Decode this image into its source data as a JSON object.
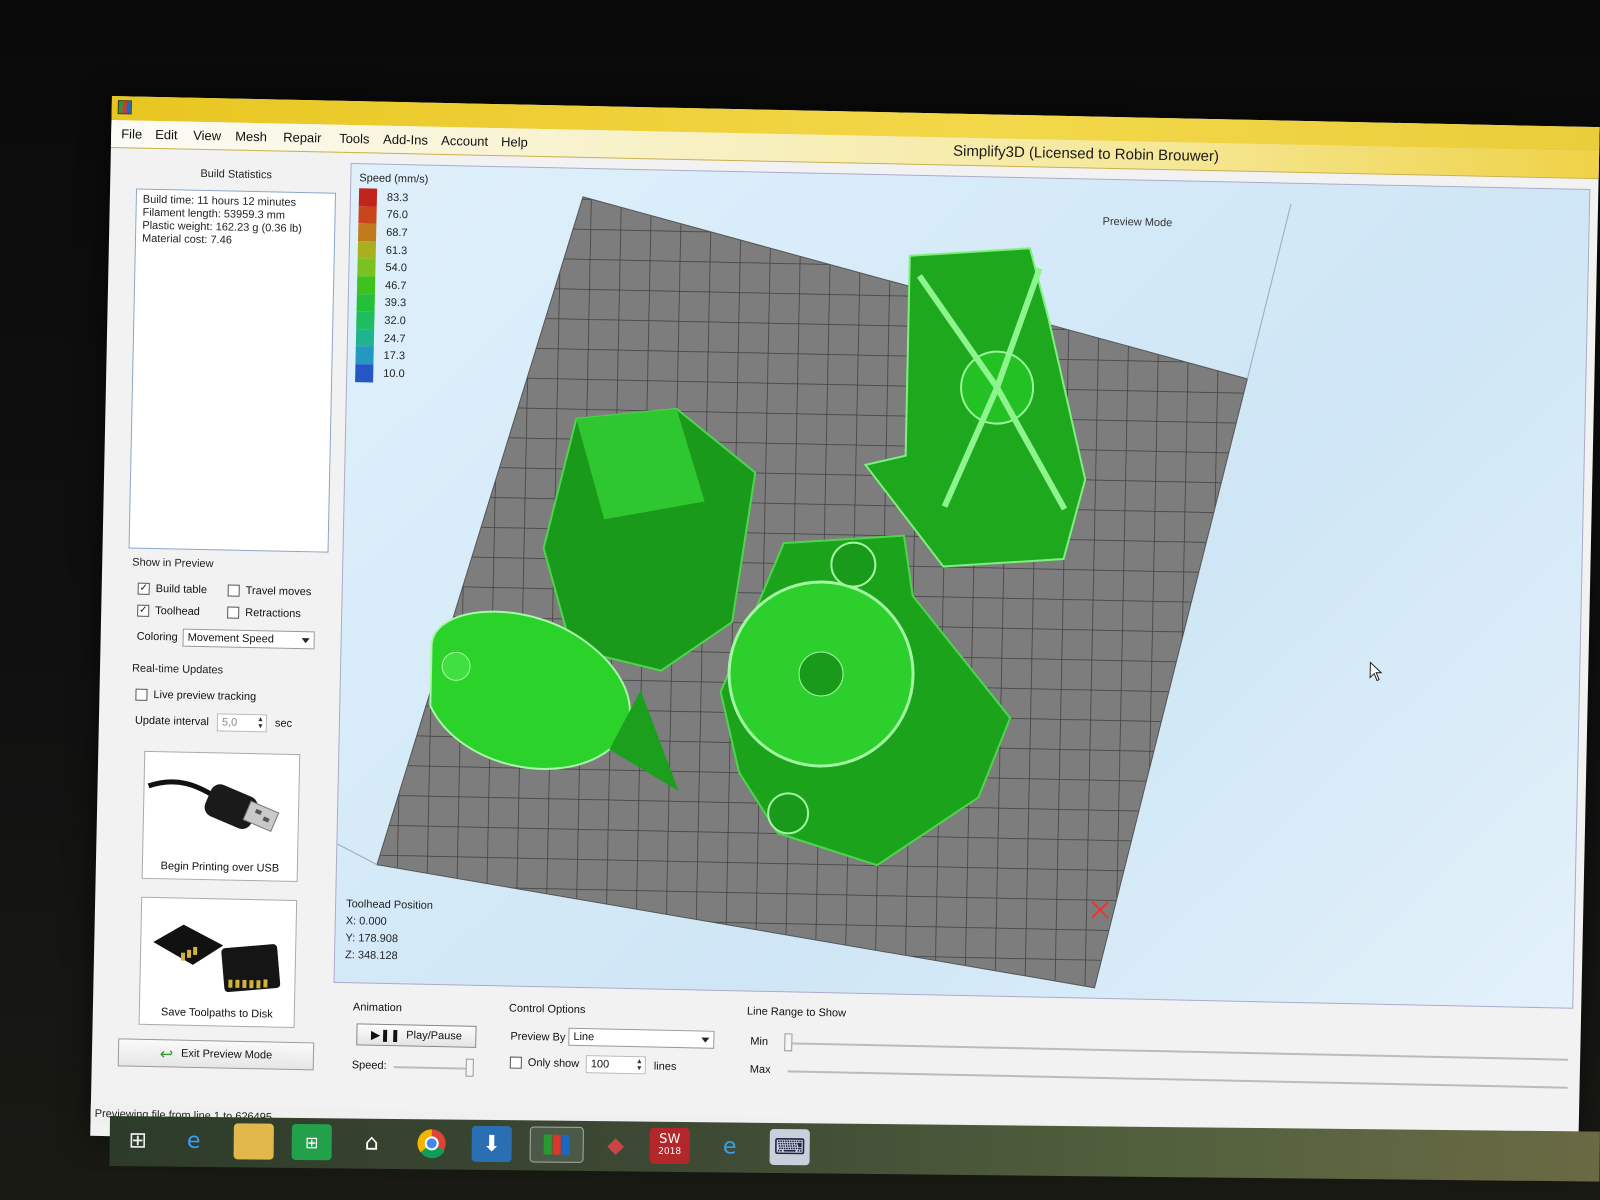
{
  "window": {
    "title": "Simplify3D (Licensed to Robin Brouwer)",
    "menu": [
      "File",
      "Edit",
      "View",
      "Mesh",
      "Repair",
      "Tools",
      "Add-Ins",
      "Account",
      "Help"
    ]
  },
  "build_statistics": {
    "title": "Build Statistics",
    "lines": [
      "Build time: 11 hours 12 minutes",
      "Filament length: 53959.3 mm",
      "Plastic weight: 162.23 g (0.36 lb)",
      "Material cost: 7.46"
    ]
  },
  "show_in_preview": {
    "title": "Show in Preview",
    "build_table": {
      "label": "Build table",
      "checked": true
    },
    "travel_moves": {
      "label": "Travel moves",
      "checked": false
    },
    "toolhead": {
      "label": "Toolhead",
      "checked": true
    },
    "retractions": {
      "label": "Retractions",
      "checked": false
    },
    "coloring_label": "Coloring",
    "coloring_value": "Movement Speed"
  },
  "realtime": {
    "title": "Real-time Updates",
    "live_tracking": {
      "label": "Live preview tracking",
      "checked": false
    },
    "interval_label": "Update interval",
    "interval_value": "5,0",
    "interval_unit": "sec"
  },
  "actions": {
    "usb_label": "Begin Printing over USB",
    "disk_label": "Save Toolpaths to Disk",
    "exit_label": "Exit Preview Mode"
  },
  "viewport": {
    "mode_label": "Preview Mode",
    "legend_title": "Speed (mm/s)",
    "legend": [
      {
        "value": "83.3",
        "color": "#c0241c"
      },
      {
        "value": "76.0",
        "color": "#c9451c"
      },
      {
        "value": "68.7",
        "color": "#c27a1e"
      },
      {
        "value": "61.3",
        "color": "#a9b020"
      },
      {
        "value": "54.0",
        "color": "#7ac21f"
      },
      {
        "value": "46.7",
        "color": "#3ec31e"
      },
      {
        "value": "39.3",
        "color": "#25c03a"
      },
      {
        "value": "32.0",
        "color": "#1fbc62"
      },
      {
        "value": "24.7",
        "color": "#1fb48e"
      },
      {
        "value": "17.3",
        "color": "#2498c0"
      },
      {
        "value": "10.0",
        "color": "#2456c8"
      }
    ],
    "toolhead_title": "Toolhead Position",
    "toolhead_x": "X: 0.000",
    "toolhead_y": "Y: 178.908",
    "toolhead_z": "Z: 348.128",
    "axis_marker": "X"
  },
  "animation": {
    "title": "Animation",
    "play_label": "Play/Pause",
    "speed_label": "Speed:"
  },
  "control_options": {
    "title": "Control Options",
    "preview_by_label": "Preview By",
    "preview_by_value": "Line",
    "only_show_label": "Only show",
    "only_show_checked": false,
    "only_show_value": "100",
    "only_show_unit": "lines"
  },
  "line_range": {
    "title": "Line Range to Show",
    "min_label": "Min",
    "max_label": "Max"
  },
  "status": {
    "text": "Previewing file from line 1 to 626495"
  },
  "taskbar": {
    "badge": "2018",
    "icons": [
      "windows-start-icon",
      "internet-explorer-icon",
      "file-explorer-icon",
      "store-icon",
      "home-icon",
      "chrome-icon",
      "filezilla-icon",
      "simplify3d-icon",
      "cube-app-icon",
      "solidworks-icon",
      "edge-icon",
      "keyboard-app-icon"
    ]
  }
}
